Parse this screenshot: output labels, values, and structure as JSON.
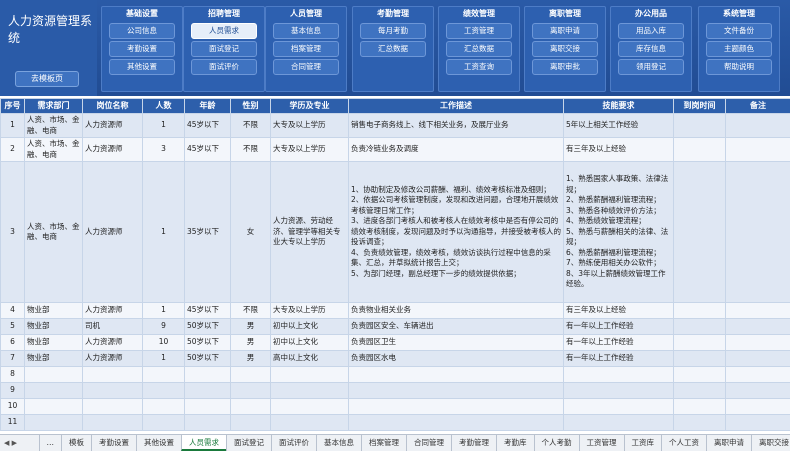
{
  "app": {
    "title": "人力资源管理系统",
    "back_label": "去模板页"
  },
  "menu": [
    {
      "title": "基础设置",
      "items": [
        "公司信息",
        "考勤设置",
        "其他设置"
      ]
    },
    {
      "title": "招聘管理",
      "items": [
        "人员需求",
        "面试登记",
        "面试评价"
      ]
    },
    {
      "title": "人员管理",
      "items": [
        "基本信息",
        "档案管理",
        "合同管理"
      ]
    },
    {
      "title": "考勤管理",
      "items": [
        "每月考勤",
        "汇总数据"
      ]
    },
    {
      "title": "绩效管理",
      "items": [
        "工资管理",
        "汇总数据",
        "工资查询"
      ]
    },
    {
      "title": "离职管理",
      "items": [
        "离职申请",
        "离职交接",
        "离职审批"
      ]
    },
    {
      "title": "办公用品",
      "items": [
        "用品入库",
        "库存信息",
        "领用登记"
      ]
    },
    {
      "title": "系统管理",
      "items": [
        "文件备份",
        "主题颜色",
        "帮助说明"
      ]
    }
  ],
  "active_menu_item": "人员需求",
  "table": {
    "headers": [
      "序号",
      "需求部门",
      "岗位名称",
      "人数",
      "年龄",
      "性别",
      "学历及专业",
      "工作描述",
      "技能要求",
      "到岗时间",
      "备注"
    ],
    "rows": [
      {
        "no": "1",
        "dept": "人资、市场、金融、电商",
        "post": "人力资源师",
        "num": "1",
        "age": "45岁以下",
        "sex": "不限",
        "edu": "大专及以上学历",
        "desc": "销售电子商务线上、线下相关业务，及展厅业务",
        "skill": "5年以上相关工作经验",
        "time": "",
        "note": ""
      },
      {
        "no": "2",
        "dept": "人资、市场、金融、电商",
        "post": "人力资源师",
        "num": "3",
        "age": "45岁以下",
        "sex": "不限",
        "edu": "大专及以上学历",
        "desc": "负责冷链业务及调度",
        "skill": "有三年及以上经验",
        "time": "",
        "note": ""
      },
      {
        "no": "3",
        "dept": "人资、市场、金融、电商",
        "post": "人力资源师",
        "num": "1",
        "age": "35岁以下",
        "sex": "女",
        "edu": "人力资源、劳动经济、管理学等相关专业大专以上学历",
        "desc": "1、协助制定及修改公司薪酬、福利、绩效考核标准及细则；\n2、依据公司考核管理制度，发现和改进问题，合理地开展绩效考核管理日常工作；\n3、进度各部门考核人和被考核人在绩效考核中是否有停公司的绩效考核制度，发现问题及时予以沟通指导，并接受被考核人的投诉调查；\n4、负责绩效管理，绩效考核，绩效访谈执行过程中信息的采集、汇总，并草拟统计报告上交；\n5、为部门经理，副总经理下一步的绩效提供依据；",
        "skill": "1、熟悉国家人事政策、法律法规；\n2、熟悉薪酬福利管理流程；\n3、熟悉各种绩效评价方法；\n4、熟悉绩效管理流程；\n5、熟悉与薪酬相关的法律、法规；\n6、熟悉薪酬福利管理流程；\n7、熟练使用相关办公软件；\n8、3年以上薪酬绩效管理工作经验。",
        "time": "",
        "note": ""
      },
      {
        "no": "4",
        "dept": "物业部",
        "post": "人力资源师",
        "num": "1",
        "age": "45岁以下",
        "sex": "不限",
        "edu": "大专及以上学历",
        "desc": "负责物业相关业务",
        "skill": "有三年及以上经验",
        "time": "",
        "note": ""
      },
      {
        "no": "5",
        "dept": "物业部",
        "post": "司机",
        "num": "9",
        "age": "50岁以下",
        "sex": "男",
        "edu": "初中以上文化",
        "desc": "负责园区安全、车辆进出",
        "skill": "有一年以上工作经验",
        "time": "",
        "note": ""
      },
      {
        "no": "6",
        "dept": "物业部",
        "post": "人力资源师",
        "num": "10",
        "age": "50岁以下",
        "sex": "男",
        "edu": "初中以上文化",
        "desc": "负责园区卫生",
        "skill": "有一年以上工作经验",
        "time": "",
        "note": ""
      },
      {
        "no": "7",
        "dept": "物业部",
        "post": "人力资源师",
        "num": "1",
        "age": "50岁以下",
        "sex": "男",
        "edu": "高中以上文化",
        "desc": "负责园区水电",
        "skill": "有一年以上工作经验",
        "time": "",
        "note": ""
      },
      {
        "no": "8",
        "dept": "",
        "post": "",
        "num": "",
        "age": "",
        "sex": "",
        "edu": "",
        "desc": "",
        "skill": "",
        "time": "",
        "note": ""
      },
      {
        "no": "9",
        "dept": "",
        "post": "",
        "num": "",
        "age": "",
        "sex": "",
        "edu": "",
        "desc": "",
        "skill": "",
        "time": "",
        "note": ""
      },
      {
        "no": "10",
        "dept": "",
        "post": "",
        "num": "",
        "age": "",
        "sex": "",
        "edu": "",
        "desc": "",
        "skill": "",
        "time": "",
        "note": ""
      },
      {
        "no": "11",
        "dept": "",
        "post": "",
        "num": "",
        "age": "",
        "sex": "",
        "edu": "",
        "desc": "",
        "skill": "",
        "time": "",
        "note": ""
      }
    ]
  },
  "sheet_tabs": [
    "…",
    "模板",
    "考勤设置",
    "其他设置",
    "人员需求",
    "面试登记",
    "面试评价",
    "基本信息",
    "档案管理",
    "合同管理",
    "考勤管理",
    "考勤库",
    "个人考勤",
    "工资管理",
    "工资库",
    "个人工资",
    "离职申请",
    "离职交接",
    "离职审"
  ],
  "active_tab": "人员需求",
  "tab_nav_icons": [
    "left-arrow-icon",
    "right-arrow-icon"
  ]
}
